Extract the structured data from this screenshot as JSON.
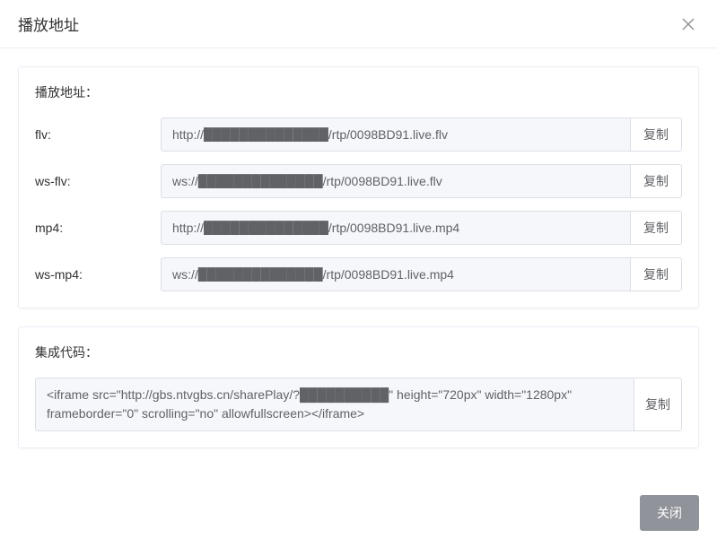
{
  "modal": {
    "title": "播放地址",
    "close_footer_label": "关闭"
  },
  "addresses_panel": {
    "label": "播放地址：",
    "copy_label": "复制",
    "rows": [
      {
        "protocol": "flv:",
        "url": "http://██████████████/rtp/0098BD91.live.flv"
      },
      {
        "protocol": "ws-flv:",
        "url": "ws://██████████████/rtp/0098BD91.live.flv"
      },
      {
        "protocol": "mp4:",
        "url": "http://██████████████/rtp/0098BD91.live.mp4"
      },
      {
        "protocol": "ws-mp4:",
        "url": "ws://██████████████/rtp/0098BD91.live.mp4"
      }
    ]
  },
  "code_panel": {
    "label": "集成代码：",
    "copy_label": "复制",
    "code": "<iframe src=\"http://gbs.ntvgbs.cn/sharePlay/?██████████\" height=\"720px\" width=\"1280px\" frameborder=\"0\" scrolling=\"no\" allowfullscreen></iframe>"
  }
}
